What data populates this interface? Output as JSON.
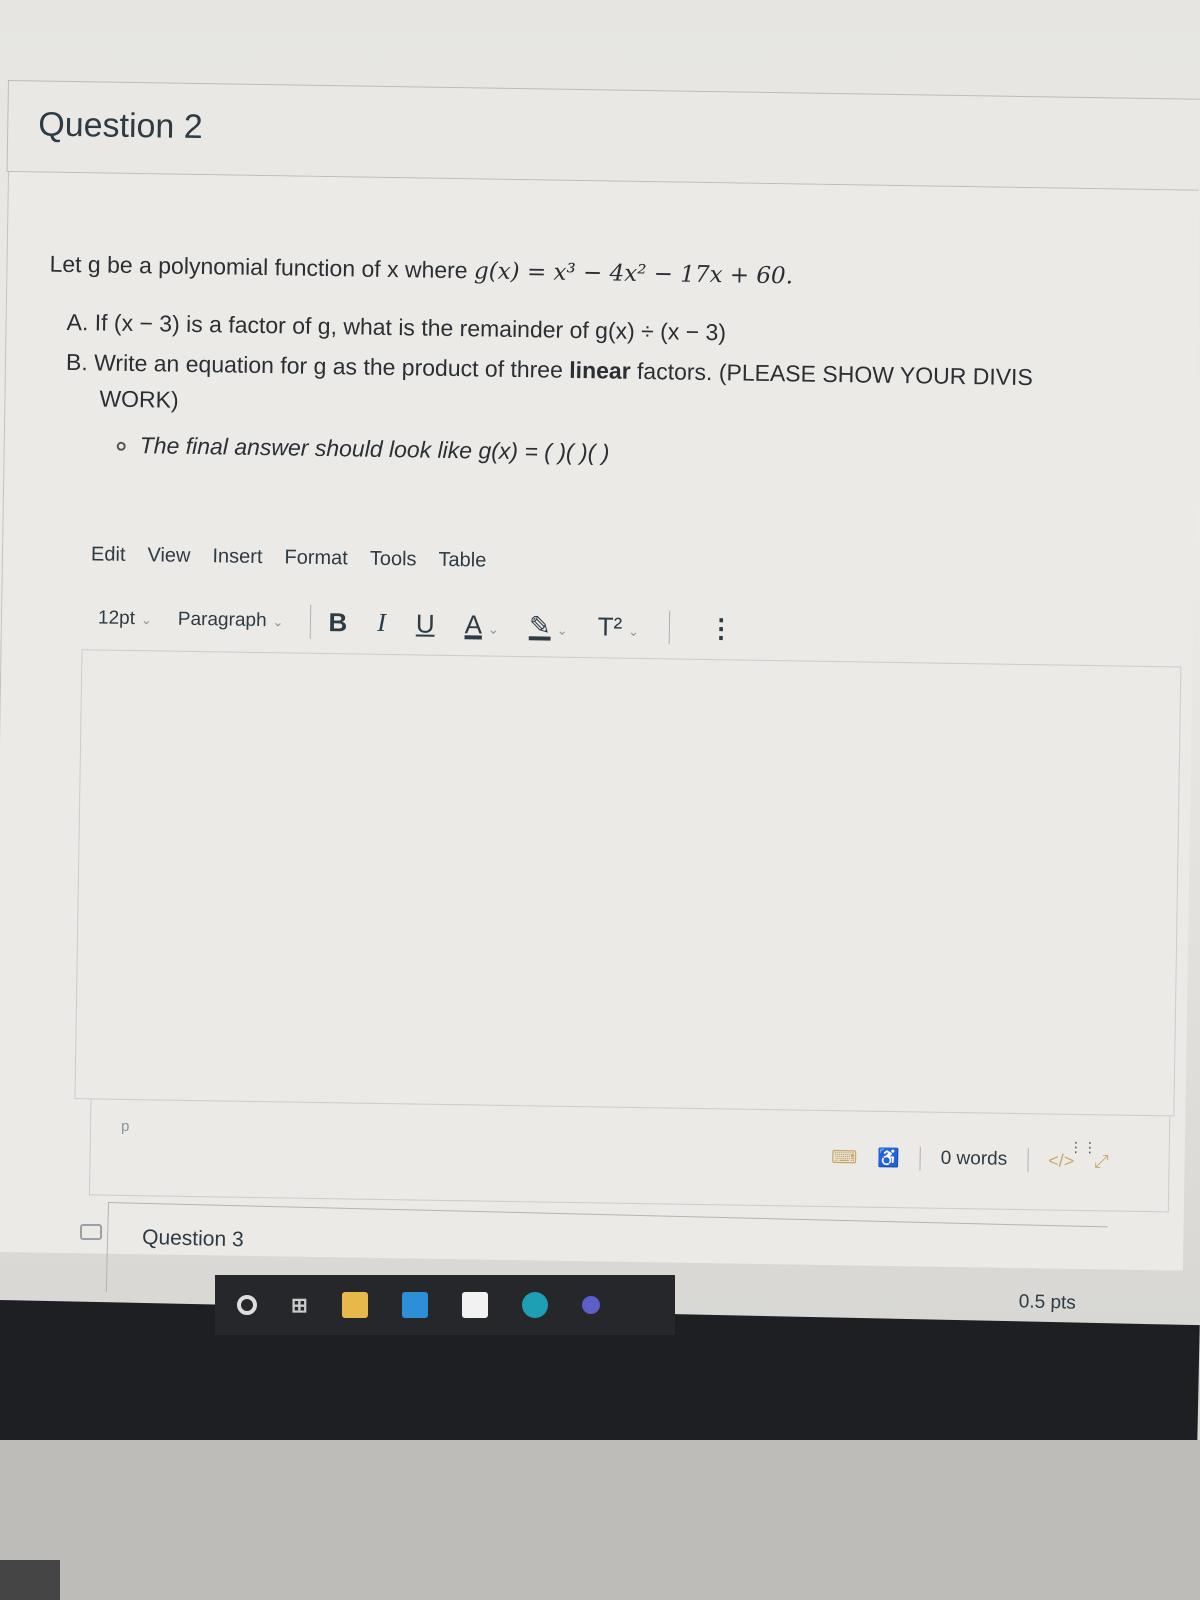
{
  "question2": {
    "title": "Question 2",
    "intro_text": "Let g be a polynomial function of x where ",
    "function_def": "g(x) = x³ − 4x² − 17x + 60.",
    "part_a": "A. If (x − 3) is a factor of g, what is the remainder of g(x) ÷ (x − 3)",
    "part_b_prefix": "B. Write an equation for g as the product of three ",
    "part_b_bold": "linear",
    "part_b_suffix": " factors. (PLEASE SHOW YOUR DIVIS",
    "part_b_cont": "WORK)",
    "hint": "The final answer should look like g(x) = (      )(      )(      )"
  },
  "editor": {
    "menu": [
      "Edit",
      "View",
      "Insert",
      "Format",
      "Tools",
      "Table"
    ],
    "font_size": "12pt",
    "block_format": "Paragraph",
    "buttons": {
      "bold": "B",
      "italic": "I",
      "underline": "U",
      "text_color": "A",
      "highlight": "✎",
      "superscript": "T²",
      "more": "⋮"
    },
    "chevron": "⌄",
    "content": "",
    "path": "p",
    "word_count": "0 words",
    "html_toggle": "</>",
    "icons": {
      "keyboard": "⌨",
      "accessibility": "♿",
      "fullscreen": "⤢",
      "resize": "⋮⋮"
    }
  },
  "question3": {
    "title": "Question 3",
    "points": "0.5 pts"
  },
  "taskbar": {
    "apps": [
      "search",
      "task-view",
      "file-explorer",
      "mail",
      "store",
      "edge",
      "teams"
    ]
  }
}
